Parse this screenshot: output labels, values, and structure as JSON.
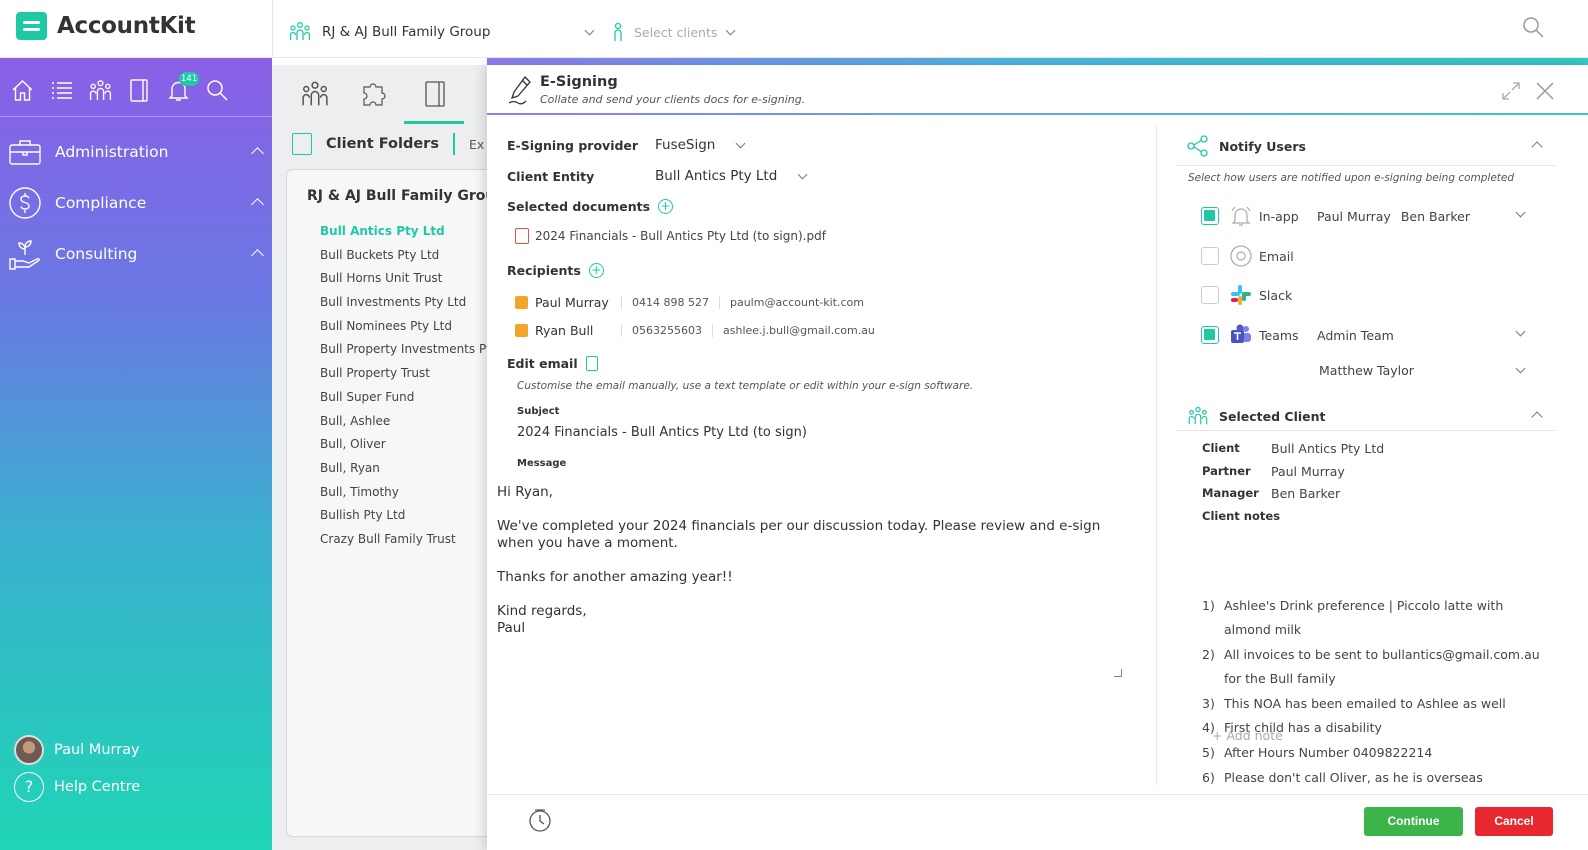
{
  "app": {
    "name": "AccountKit"
  },
  "header": {
    "group_label": "RJ & AJ Bull Family Group",
    "clients_placeholder": "Select clients"
  },
  "sidebar": {
    "notification_count": "141",
    "nav": [
      {
        "label": "Administration"
      },
      {
        "label": "Compliance"
      },
      {
        "label": "Consulting"
      }
    ],
    "user_name": "Paul Murray",
    "help_label": "Help Centre"
  },
  "folders": {
    "title": "Client Folders",
    "tab_extra": "Ex",
    "card_title": "RJ & AJ Bull Family Group",
    "clients": [
      "Bull Antics Pty Ltd",
      "Bull Buckets Pty Ltd",
      "Bull Horns Unit Trust",
      "Bull Investments Pty Ltd",
      "Bull Nominees Pty Ltd",
      "Bull Property Investments Pty Ltd",
      "Bull Property Trust",
      "Bull Super Fund",
      "Bull, Ashlee",
      "Bull, Oliver",
      "Bull, Ryan",
      "Bull, Timothy",
      "Bullish Pty Ltd",
      "Crazy Bull Family Trust"
    ]
  },
  "modal": {
    "title": "E-Signing",
    "subtitle": "Collate and send your clients docs for e-signing.",
    "provider_label": "E-Signing provider",
    "provider_value": "FuseSign",
    "entity_label": "Client Entity",
    "entity_value": "Bull Antics Pty Ltd",
    "documents_label": "Selected documents",
    "document": "2024 Financials - Bull Antics Pty Ltd (to sign).pdf",
    "recipients_label": "Recipients",
    "recipients": [
      {
        "name": "Paul Murray",
        "phone": "0414 898 527",
        "email": "paulm@account-kit.com"
      },
      {
        "name": "Ryan Bull",
        "phone": "0563255603",
        "email": "ashlee.j.bull@gmail.com.au"
      }
    ],
    "edit_email_label": "Edit email",
    "edit_email_hint": "Customise the email manually, use a text template or edit within your e-sign software.",
    "subject_label": "Subject",
    "subject_value": "2024 Financials - Bull Antics Pty Ltd (to sign)",
    "message_label": "Message",
    "message": {
      "greeting": "Hi Ryan,",
      "body": "We've completed your 2024 financials per our discussion today. Please review and e-sign when you have a moment.",
      "thanks": "Thanks for another amazing year!!",
      "signoff": "Kind regards,",
      "sender": "Paul"
    },
    "notify": {
      "title": "Notify Users",
      "hint": "Select how users are notified upon e-signing being completed",
      "channels": [
        {
          "label": "In-app",
          "checked": true,
          "users": [
            "Paul Murray",
            "Ben Barker"
          ]
        },
        {
          "label": "Email",
          "checked": false,
          "users": []
        },
        {
          "label": "Slack",
          "checked": false,
          "users": []
        },
        {
          "label": "Teams",
          "checked": true,
          "users": [
            "Admin Team"
          ]
        }
      ],
      "extra_user": "Matthew Taylor"
    },
    "selected_client": {
      "title": "Selected Client",
      "client_label": "Client",
      "client_value": "Bull Antics Pty Ltd",
      "partner_label": "Partner",
      "partner_value": "Paul Murray",
      "manager_label": "Manager",
      "manager_value": "Ben Barker",
      "notes_label": "Client notes",
      "notes": [
        {
          "num": "1)",
          "text": "Ashlee's Drink preference | Piccolo latte with almond milk"
        },
        {
          "num": "2)",
          "text": "All invoices to be sent to bullantics@gmail.com.au for the Bull family"
        },
        {
          "num": "3)",
          "text": "This NOA has been emailed to Ashlee as well"
        },
        {
          "num": "4)",
          "text": "First child has a disability"
        },
        {
          "num": "5)",
          "text": "After Hours Number 0409822214"
        },
        {
          "num": "6)",
          "text": "Please don't call Oliver, as he is overseas"
        }
      ],
      "add_note": "+ Add note"
    },
    "continue_label": "Continue",
    "cancel_label": "Cancel"
  },
  "colors": {
    "accent": "#1fc9a6",
    "continue": "#3bb54a",
    "cancel": "#e8282e",
    "pdf": "#e0554b",
    "edit": "#f2a42b"
  }
}
